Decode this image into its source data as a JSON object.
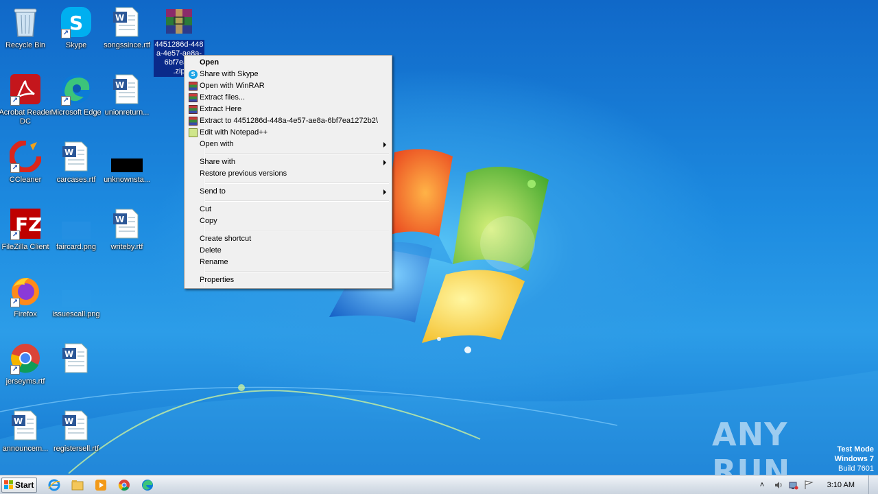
{
  "desktop": {
    "icons": [
      {
        "label": "Recycle Bin"
      },
      {
        "label": "Skype"
      },
      {
        "label": "songssince.rtf"
      },
      {
        "label": "Acrobat Reader DC"
      },
      {
        "label": "Microsoft Edge"
      },
      {
        "label": "unionreturn..."
      },
      {
        "label": "CCleaner"
      },
      {
        "label": "carcases.rtf"
      },
      {
        "label": "unknownsta..."
      },
      {
        "label": "FileZilla Client"
      },
      {
        "label": "faircard.png"
      },
      {
        "label": "writeby.rtf"
      },
      {
        "label": "Firefox"
      },
      {
        "label": "issuescall.png"
      },
      {
        "label": "Google Chrome"
      },
      {
        "label": "jerseyms.rtf"
      },
      {
        "label": "announcem..."
      },
      {
        "label": "registersell.rtf"
      }
    ],
    "selected_file": {
      "label_lines": [
        "4451286d-448",
        "a-4e57-ae8a-",
        "6bf7ea1:",
        ".zip"
      ]
    }
  },
  "context_menu": {
    "items": [
      {
        "label": "Open",
        "icon": "",
        "bold": true
      },
      {
        "label": "Share with Skype",
        "icon": "skype-icon"
      },
      {
        "label": "Open with WinRAR",
        "icon": "winrar-icon"
      },
      {
        "label": "Extract files...",
        "icon": "winrar-icon"
      },
      {
        "label": "Extract Here",
        "icon": "winrar-icon"
      },
      {
        "label": "Extract to 4451286d-448a-4e57-ae8a-6bf7ea1272b2\\",
        "icon": "winrar-icon"
      },
      {
        "label": "Edit with Notepad++",
        "icon": "notepadpp-icon"
      },
      {
        "label": "Open with",
        "submenu": true
      },
      {
        "label": "Share with",
        "submenu": true
      },
      {
        "label": "Restore previous versions"
      },
      {
        "label": "Send to",
        "submenu": true
      },
      {
        "label": "Cut"
      },
      {
        "label": "Copy"
      },
      {
        "label": "Create shortcut"
      },
      {
        "label": "Delete"
      },
      {
        "label": "Rename"
      },
      {
        "label": "Properties"
      }
    ]
  },
  "taskbar": {
    "start_label": "Start",
    "pinned": [
      "internet-explorer-icon",
      "file-explorer-icon",
      "media-player-icon",
      "chrome-icon",
      "edge-icon"
    ],
    "clock": "3:10 AM"
  },
  "watermark": {
    "text": "ANY RUN"
  },
  "test_mode": {
    "line1": "Test Mode",
    "line2": "Windows 7",
    "line3": "Build 7601"
  },
  "colors": {
    "selection": "#0a2a8a",
    "menu_bg": "#f0f0f0",
    "wallpaper": "#1b7fd6"
  }
}
